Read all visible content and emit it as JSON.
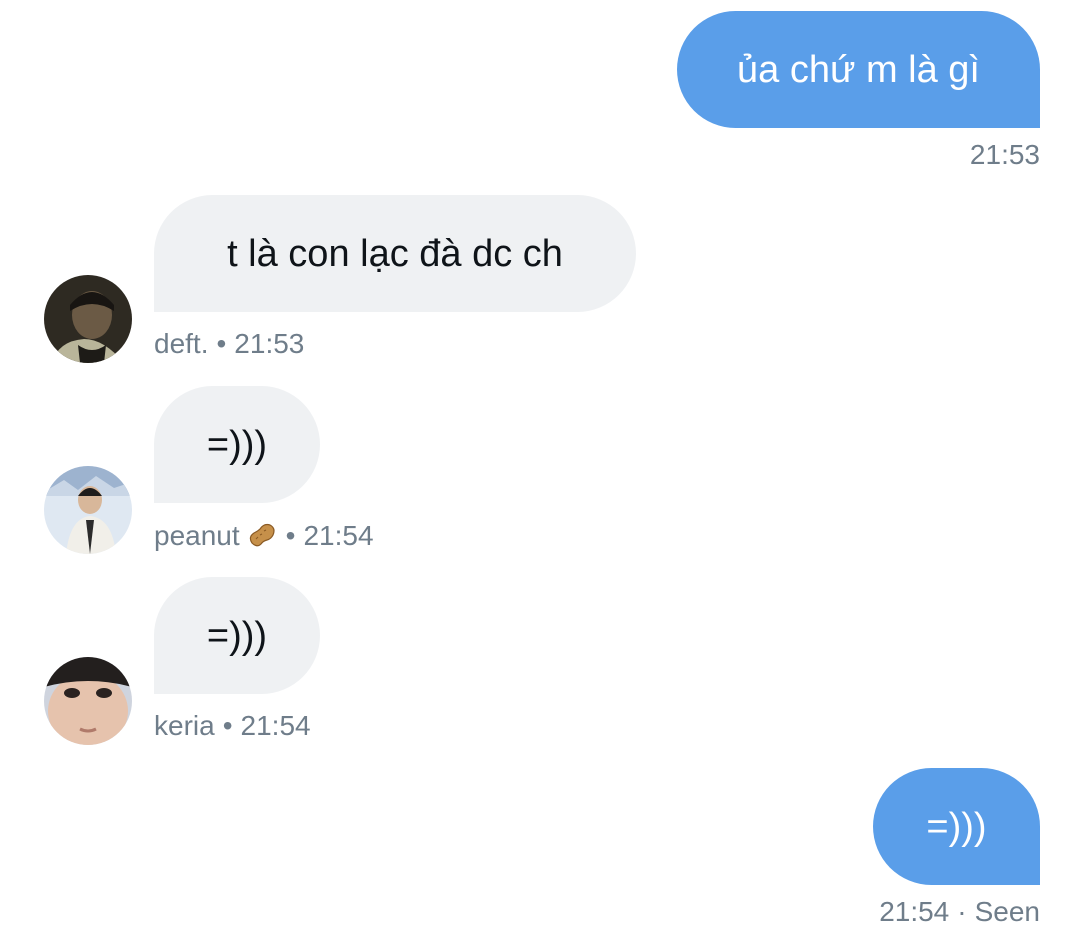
{
  "messages": [
    {
      "direction": "outgoing",
      "text": "ủa chứ m là gì",
      "time": "21:53"
    },
    {
      "direction": "incoming",
      "text": "t là con lạc đà dc ch",
      "sender": "deft.",
      "time": "21:53"
    },
    {
      "direction": "incoming",
      "text": "=)))",
      "sender": "peanut",
      "sender_emoji": "peanut-icon",
      "time": "21:54"
    },
    {
      "direction": "incoming",
      "text": "=)))",
      "sender": "keria",
      "time": "21:54"
    },
    {
      "direction": "outgoing",
      "text": "=)))",
      "time": "21:54",
      "status": "Seen"
    }
  ],
  "separator": "•",
  "status_separator": "·",
  "colors": {
    "outgoing_bubble": "#5a9ee9",
    "incoming_bubble": "#eff1f3",
    "meta_text": "#6f7d8a"
  }
}
